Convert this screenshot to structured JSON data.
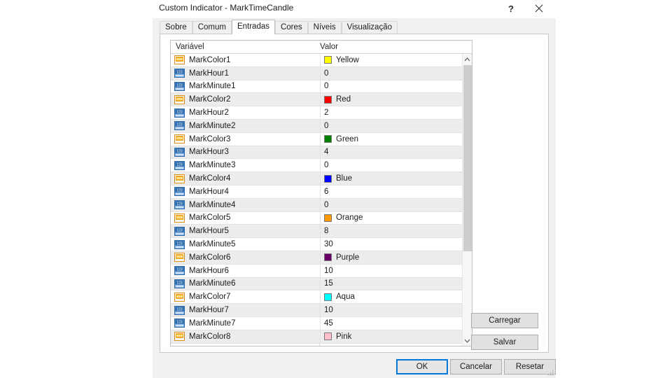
{
  "window": {
    "title": "Custom Indicator - MarkTimeCandle",
    "help_label": "?",
    "close_label": "✕"
  },
  "tabs": [
    {
      "label": "Sobre",
      "active": false
    },
    {
      "label": "Comum",
      "active": false
    },
    {
      "label": "Entradas",
      "active": true
    },
    {
      "label": "Cores",
      "active": false
    },
    {
      "label": "Níveis",
      "active": false
    },
    {
      "label": "Visualização",
      "active": false
    }
  ],
  "grid": {
    "columns": [
      "Variável",
      "Valor"
    ],
    "rows": [
      {
        "icon": "color-swatch-icon",
        "variable": "MarkColor1",
        "value": "Yellow",
        "color": "#ffff00"
      },
      {
        "icon": "number-123-icon",
        "variable": "MarkHour1",
        "value": "0"
      },
      {
        "icon": "number-123-icon",
        "variable": "MarkMinute1",
        "value": "0"
      },
      {
        "icon": "color-swatch-icon",
        "variable": "MarkColor2",
        "value": "Red",
        "color": "#ff0000"
      },
      {
        "icon": "number-123-icon",
        "variable": "MarkHour2",
        "value": "2"
      },
      {
        "icon": "number-123-icon",
        "variable": "MarkMinute2",
        "value": "0"
      },
      {
        "icon": "color-swatch-icon",
        "variable": "MarkColor3",
        "value": "Green",
        "color": "#008000"
      },
      {
        "icon": "number-123-icon",
        "variable": "MarkHour3",
        "value": "4"
      },
      {
        "icon": "number-123-icon",
        "variable": "MarkMinute3",
        "value": "0"
      },
      {
        "icon": "color-swatch-icon",
        "variable": "MarkColor4",
        "value": "Blue",
        "color": "#0000ff"
      },
      {
        "icon": "number-123-icon",
        "variable": "MarkHour4",
        "value": "6"
      },
      {
        "icon": "number-123-icon",
        "variable": "MarkMinute4",
        "value": "0"
      },
      {
        "icon": "color-swatch-icon",
        "variable": "MarkColor5",
        "value": "Orange",
        "color": "#ff9900"
      },
      {
        "icon": "number-123-icon",
        "variable": "MarkHour5",
        "value": "8"
      },
      {
        "icon": "number-123-icon",
        "variable": "MarkMinute5",
        "value": "30"
      },
      {
        "icon": "color-swatch-icon",
        "variable": "MarkColor6",
        "value": "Purple",
        "color": "#6b006b"
      },
      {
        "icon": "number-123-icon",
        "variable": "MarkHour6",
        "value": "10"
      },
      {
        "icon": "number-123-icon",
        "variable": "MarkMinute6",
        "value": "15"
      },
      {
        "icon": "color-swatch-icon",
        "variable": "MarkColor7",
        "value": "Aqua",
        "color": "#00ffff"
      },
      {
        "icon": "number-123-icon",
        "variable": "MarkHour7",
        "value": "10"
      },
      {
        "icon": "number-123-icon",
        "variable": "MarkMinute7",
        "value": "45"
      },
      {
        "icon": "color-swatch-icon",
        "variable": "MarkColor8",
        "value": "Pink",
        "color": "#ffc0cb"
      }
    ]
  },
  "side_buttons": {
    "load_label": "Carregar",
    "save_label": "Salvar"
  },
  "bottom_buttons": {
    "ok_label": "OK",
    "cancel_label": "Cancelar",
    "reset_label": "Resetar"
  },
  "theme": {
    "accent": "#0078d7",
    "dialog_bg": "#f0f0f0",
    "row_alt_bg": "#ececec"
  }
}
